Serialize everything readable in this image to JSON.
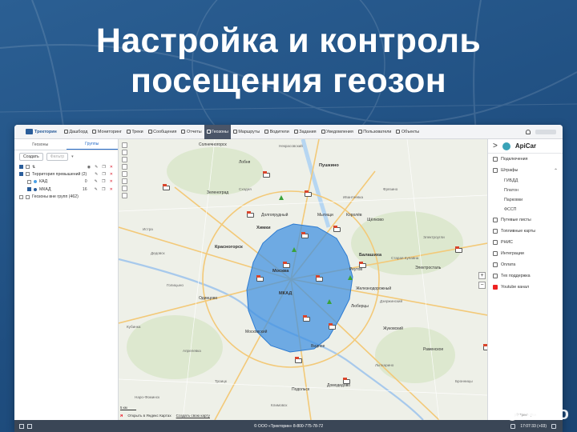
{
  "headline": {
    "line1": "Настройка и контроль",
    "line2": "посещения геозон"
  },
  "app": {
    "brand": "Тректорин",
    "nav": [
      {
        "label": "Дашборд",
        "icon": "dashboard-icon"
      },
      {
        "label": "Мониторинг",
        "icon": "monitoring-icon"
      },
      {
        "label": "Треки",
        "icon": "tracks-icon"
      },
      {
        "label": "Сообщения",
        "icon": "messages-icon"
      },
      {
        "label": "Отчеты",
        "icon": "reports-icon"
      },
      {
        "label": "Геозоны",
        "icon": "geozone-icon",
        "active": true
      },
      {
        "label": "Маршруты",
        "icon": "routes-icon"
      },
      {
        "label": "Водители",
        "icon": "drivers-icon"
      },
      {
        "label": "Задания",
        "icon": "tasks-icon"
      },
      {
        "label": "Уведомления",
        "icon": "notifications-icon"
      },
      {
        "label": "Пользователи",
        "icon": "users-icon"
      },
      {
        "label": "Объекты",
        "icon": "objects-icon"
      }
    ]
  },
  "left_panel": {
    "tabs": [
      "Геозоны",
      "Группы"
    ],
    "active_tab": "Группы",
    "create_button": "Создать",
    "filter_button": "Фильтр",
    "groups": [
      {
        "label": "Территория превышений (2)",
        "children": [
          {
            "label": "КАД",
            "count": "0",
            "color": "#4aa0e6",
            "checked": false
          },
          {
            "label": "МКАД",
            "count": "16",
            "color": "#2a5d9a",
            "checked": true
          }
        ]
      },
      {
        "label": "Геозоны вне групп (462)",
        "children": []
      }
    ]
  },
  "map": {
    "geozone_color": "#3d8fe0",
    "labels": [
      {
        "text": "Солнечногорск"
      },
      {
        "text": "Некрасовский"
      },
      {
        "text": "Лобня"
      },
      {
        "text": "Пушкино"
      },
      {
        "text": "Зеленоград"
      },
      {
        "text": "Долгопрудный"
      },
      {
        "text": "Мытищи"
      },
      {
        "text": "Королёв"
      },
      {
        "text": "Химки"
      },
      {
        "text": "Щёлково"
      },
      {
        "text": "Красногорск"
      },
      {
        "text": "Балашиха"
      },
      {
        "text": "Москва"
      },
      {
        "text": "Реутов"
      },
      {
        "text": "Электросталь"
      },
      {
        "text": "Старая Купавна"
      },
      {
        "text": "Одинцово"
      },
      {
        "text": "Железнодорожный"
      },
      {
        "text": "Люберцы"
      },
      {
        "text": "Московский"
      },
      {
        "text": "Видное"
      },
      {
        "text": "Жуковский"
      },
      {
        "text": "Домодедово"
      },
      {
        "text": "Подольск"
      },
      {
        "text": "Раменское"
      },
      {
        "text": "Голицыно"
      },
      {
        "text": "Кубинка"
      },
      {
        "text": "Апрелевка"
      },
      {
        "text": "Дзержинский"
      },
      {
        "text": "Лыткарино"
      },
      {
        "text": "Бронницы"
      },
      {
        "text": "Электроугли"
      },
      {
        "text": "Фрязино"
      },
      {
        "text": "Ивантеевка"
      },
      {
        "text": "Сходня"
      },
      {
        "text": "Истра"
      },
      {
        "text": "Дедовск"
      },
      {
        "text": "Климовск"
      },
      {
        "text": "Троицк"
      },
      {
        "text": "Наро-Фоминск"
      }
    ],
    "mkad_label": "МКАД",
    "yandex_logo": "Я",
    "yandex_open": "Открыть в Яндекс Картах",
    "yandex_create": "Создать свою карту",
    "scale": "5 км"
  },
  "right_panel": {
    "brand": "ApiCar",
    "items": [
      {
        "label": "Подключения",
        "icon": "connections-icon"
      },
      {
        "label": "Штрафы",
        "icon": "fines-icon",
        "expanded": true,
        "children": [
          "ГИБДД",
          "Платон",
          "Парковки",
          "ФССП"
        ]
      },
      {
        "label": "Путевые листы",
        "icon": "waybills-icon"
      },
      {
        "label": "Топливные карты",
        "icon": "fuel-cards-icon"
      },
      {
        "label": "РНИС",
        "icon": "rnis-icon"
      },
      {
        "label": "Интеграции",
        "icon": "integrations-icon"
      },
      {
        "label": "Оплата",
        "icon": "payment-icon"
      },
      {
        "label": "Тех поддержка",
        "icon": "support-icon"
      },
      {
        "label": "Youtube канал",
        "icon": "youtube-icon"
      }
    ],
    "copyright": "(с) Тректорин"
  },
  "status_bar": {
    "center": "© ООО «Тректорин» 8-800-775-78-72",
    "time": "17:07:33 (+03)"
  },
  "watermark": {
    "text": "Avito"
  }
}
